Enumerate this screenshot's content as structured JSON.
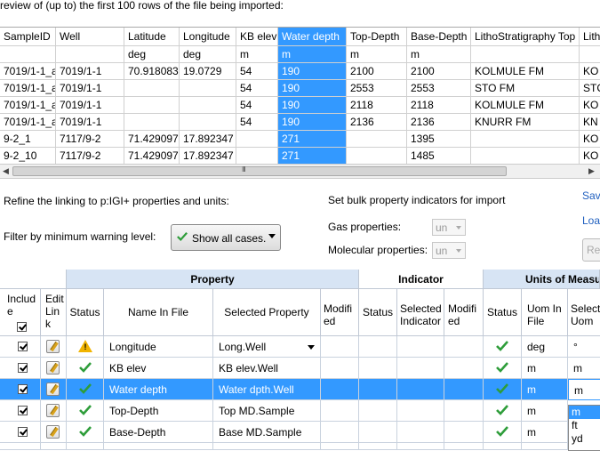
{
  "caption": "review of (up to) the first 100 rows of the file being imported:",
  "preview": {
    "columns": [
      "SampleID",
      "Well",
      "Latitude",
      "Longitude",
      "KB elev",
      "Water depth",
      "Top-Depth",
      "Base-Depth",
      "LithoStratigraphy Top",
      "Lith"
    ],
    "units": [
      "",
      "",
      "deg",
      "deg",
      "m",
      "m",
      "m",
      "m",
      "",
      ""
    ],
    "rows": [
      [
        "7019/1-1_a1",
        "7019/1-1",
        "70.918083",
        "19.0729",
        "54",
        "190",
        "2100",
        "2100",
        "KOLMULE FM",
        "KO"
      ],
      [
        "7019/1-1_a2",
        "7019/1-1",
        "",
        "",
        "54",
        "190",
        "2553",
        "2553",
        "STO FM",
        "STC"
      ],
      [
        "7019/1-1_a3",
        "7019/1-1",
        "",
        "",
        "54",
        "190",
        "2118",
        "2118",
        "KOLMULE FM",
        "KO"
      ],
      [
        "7019/1-1_a4",
        "7019/1-1",
        "",
        "",
        "54",
        "190",
        "2136",
        "2136",
        "KNURR FM",
        "KN"
      ],
      [
        "9-2_1",
        "7117/9-2",
        "71.429097",
        "17.892347",
        "",
        "271",
        "",
        "1395",
        "",
        "KO"
      ],
      [
        "9-2_10",
        "7117/9-2",
        "71.429097",
        "17.892347",
        "",
        "271",
        "",
        "1485",
        "",
        "KO"
      ]
    ],
    "scroll_grip": "III"
  },
  "refine_label": "Refine the linking to p:IGI+ properties and units:",
  "filter_label": "Filter by minimum warning level:",
  "filter_value": "Show all cases.",
  "bulk": {
    "title": "Set bulk property indicators for import",
    "gas_label": "Gas properties:",
    "gas_value": "un",
    "molecular_label": "Molecular properties:",
    "molecular_value": "un"
  },
  "links": {
    "save": "Sav",
    "load": "Loa",
    "reset": "Res"
  },
  "grid": {
    "groups": {
      "property": "Property",
      "indicator": "Indicator",
      "units": "Units of Measur"
    },
    "headers": {
      "include": "Includ e",
      "edit": "Edit Lin k",
      "status": "Status",
      "name_in_file": "Name In File",
      "selected_property": "Selected Property",
      "modified": "Modifi ed",
      "ind_status": "Status",
      "selected_indicator": "Selected Indicator",
      "ind_modified": "Modifi ed",
      "uom_status": "Status",
      "uom_in_file": "Uom In File",
      "selected_uom": "Selecte Uom"
    },
    "rows": [
      {
        "status": "warning",
        "name": "Longitude",
        "property": "Long.Well",
        "uom": "deg",
        "sel_uom": "°",
        "selected": false,
        "has_dropdown": true
      },
      {
        "status": "ok",
        "name": "KB elev",
        "property": "KB elev.Well",
        "uom": "m",
        "sel_uom": "m",
        "selected": false,
        "has_dropdown": false
      },
      {
        "status": "ok",
        "name": "Water depth",
        "property": "Water dpth.Well",
        "uom": "m",
        "sel_uom": "m",
        "selected": true,
        "has_dropdown": false
      },
      {
        "status": "ok",
        "name": "Top-Depth",
        "property": "Top MD.Sample",
        "uom": "m",
        "sel_uom": "",
        "selected": false,
        "has_dropdown": false
      },
      {
        "status": "ok",
        "name": "Base-Depth",
        "property": "Base MD.Sample",
        "uom": "m",
        "sel_uom": "",
        "selected": false,
        "has_dropdown": false
      }
    ],
    "uom_options": [
      "m",
      "ft",
      "yd"
    ]
  },
  "colors": {
    "selection": "#3399ff",
    "group_header": "#d7e4f4",
    "ok_green": "#2e9d3a",
    "warning": "#f1b400"
  }
}
